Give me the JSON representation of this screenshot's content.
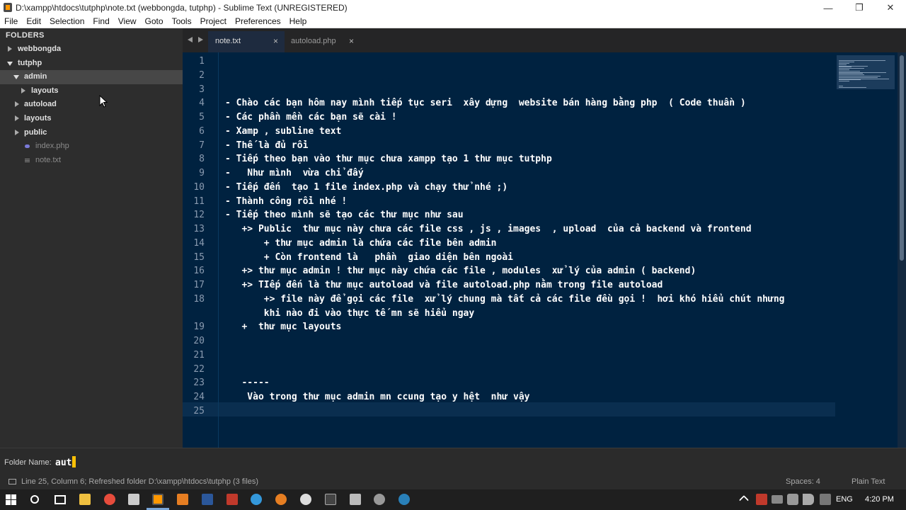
{
  "window": {
    "title": "D:\\xampp\\htdocs\\tutphp\\note.txt (webbongda, tutphp) - Sublime Text (UNREGISTERED)",
    "minimize_glyph": "—",
    "maximize_glyph": "❐",
    "close_glyph": "✕"
  },
  "menu": [
    "File",
    "Edit",
    "Selection",
    "Find",
    "View",
    "Goto",
    "Tools",
    "Project",
    "Preferences",
    "Help"
  ],
  "sidebar": {
    "header": "FOLDERS",
    "items": [
      {
        "label": "webbongda",
        "type": "folder",
        "expanded": false,
        "depth": 0
      },
      {
        "label": "tutphp",
        "type": "folder",
        "expanded": true,
        "depth": 0
      },
      {
        "label": "admin",
        "type": "folder",
        "expanded": true,
        "depth": 1,
        "selected": true
      },
      {
        "label": "layouts",
        "type": "folder",
        "expanded": false,
        "depth": 2
      },
      {
        "label": "autoload",
        "type": "folder",
        "expanded": false,
        "depth": 1
      },
      {
        "label": "layouts",
        "type": "folder",
        "expanded": false,
        "depth": 1
      },
      {
        "label": "public",
        "type": "folder",
        "expanded": false,
        "depth": 1
      },
      {
        "label": "index.php",
        "type": "file",
        "icon": "php-file-icon",
        "depth": 1
      },
      {
        "label": "note.txt",
        "type": "file",
        "icon": "text-file-icon",
        "depth": 1
      }
    ]
  },
  "tabs": [
    {
      "label": "note.txt",
      "active": true,
      "close": "×"
    },
    {
      "label": "autoload.php",
      "active": false,
      "close": "×"
    }
  ],
  "editor": {
    "current_line": 25,
    "lines": [
      {
        "n": "1",
        "text": ""
      },
      {
        "n": "2",
        "text": ""
      },
      {
        "n": "3",
        "text": ""
      },
      {
        "n": "4",
        "text": "- Chào các bạn hôm nay mình tiếp tục seri  xây dựng  website bán hàng bằng php  ( Code thuần )"
      },
      {
        "n": "5",
        "text": "- Các phần mền các bạn sẽ cài !"
      },
      {
        "n": "6",
        "text": "- Xamp , subline text"
      },
      {
        "n": "7",
        "text": "- Thế là đủ rồi"
      },
      {
        "n": "8",
        "text": "- Tiếp theo bạn vào thư mục chưa xampp tạo 1 thư mục tutphp"
      },
      {
        "n": "9",
        "text": "-   Như mình  vừa chỉ đấy"
      },
      {
        "n": "10",
        "text": "- Tiếp đến  tạo 1 file index.php và chạy thử nhé ;)"
      },
      {
        "n": "11",
        "text": "- Thành công rồi nhé !"
      },
      {
        "n": "12",
        "text": "- Tiếp theo mình sẽ tạo các thư mục như sau"
      },
      {
        "n": "13",
        "text": "   +> Public  thư mục này chưa các file css , js , images  , upload  của cả backend và frontend"
      },
      {
        "n": "14",
        "text": "       + thư mục admin là chứa các file bên admin"
      },
      {
        "n": "15",
        "text": "       + Còn frontend là   phần  giao diện bên ngoài"
      },
      {
        "n": "16",
        "text": "   +> thư mục admin ! thư mục này chứa các file , modules  xử lý của admin ( backend)"
      },
      {
        "n": "17",
        "text": "   +> TIếp đến là thư mục autoload và file autoload.php nằm trong file autoload"
      },
      {
        "n": "18",
        "text": "       +> file này để gọi các file  xử lý chung mà tất cả các file đều gọi !  hơi khó hiểu chút nhưng"
      },
      {
        "n": "",
        "text": "       khi nào đi vào thực tế mn sẽ hiểu ngay"
      },
      {
        "n": "19",
        "text": "   +  thư mục layouts"
      },
      {
        "n": "20",
        "text": ""
      },
      {
        "n": "21",
        "text": ""
      },
      {
        "n": "22",
        "text": ""
      },
      {
        "n": "23",
        "text": "   -----"
      },
      {
        "n": "24",
        "text": "    Vào trong thư mục admin mn ccung tạo y hệt  như vậy"
      },
      {
        "n": "25",
        "text": ""
      }
    ]
  },
  "input_panel": {
    "label": "Folder Name:",
    "value": "aut"
  },
  "status": {
    "text": "Line 25, Column 6; Refreshed folder D:\\xampp\\htdocs\\tutphp (3 files)",
    "spaces": "Spaces: 4",
    "syntax": "Plain Text"
  },
  "taskbar": {
    "language": "ENG",
    "time": "4:20 PM",
    "colors": {
      "accent": "#7aa6d6"
    }
  }
}
